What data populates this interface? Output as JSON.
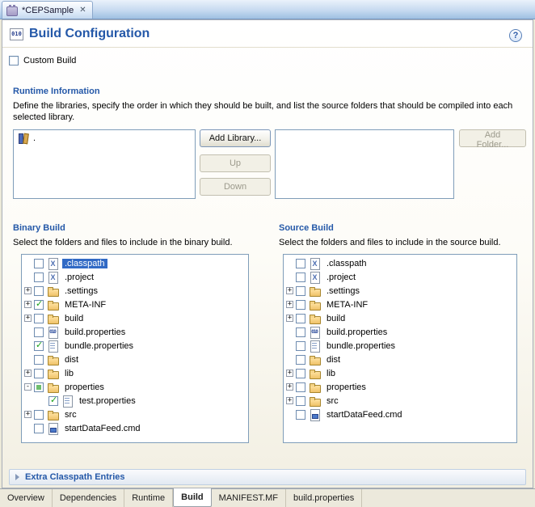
{
  "editor_tab": {
    "title": "*CEPSample"
  },
  "header": {
    "title": "Build Configuration"
  },
  "custom_build": {
    "label": "Custom Build"
  },
  "runtime": {
    "title": "Runtime Information",
    "description": "Define the libraries, specify the order in which they should be built, and list the source folders that should be compiled into each selected library.",
    "libraries": [
      {
        "label": ".",
        "icon": "library"
      }
    ],
    "buttons": {
      "add_library": "Add Library...",
      "up": "Up",
      "down": "Down",
      "add_folder": "Add Folder..."
    }
  },
  "binary_build": {
    "title": "Binary Build",
    "description": "Select the folders and files to include in the binary build.",
    "items": [
      {
        "label": ".classpath",
        "icon": "xml",
        "check": "unchecked",
        "expand": "none",
        "indent": 0,
        "selected": true
      },
      {
        "label": ".project",
        "icon": "xml",
        "check": "unchecked",
        "expand": "none",
        "indent": 0
      },
      {
        "label": ".settings",
        "icon": "folder",
        "check": "unchecked",
        "expand": "plus",
        "indent": 0
      },
      {
        "label": "META-INF",
        "icon": "folder",
        "check": "checked",
        "expand": "plus",
        "indent": 0
      },
      {
        "label": "build",
        "icon": "folder",
        "check": "unchecked",
        "expand": "plus",
        "indent": 0
      },
      {
        "label": "build.properties",
        "icon": "binfile",
        "check": "unchecked",
        "expand": "none",
        "indent": 0
      },
      {
        "label": "bundle.properties",
        "icon": "propfile",
        "check": "checked",
        "expand": "none",
        "indent": 0
      },
      {
        "label": "dist",
        "icon": "folder",
        "check": "unchecked",
        "expand": "none",
        "indent": 0
      },
      {
        "label": "lib",
        "icon": "folder",
        "check": "unchecked",
        "expand": "plus",
        "indent": 0
      },
      {
        "label": "properties",
        "icon": "folder",
        "check": "partial",
        "expand": "minus",
        "indent": 0
      },
      {
        "label": "test.properties",
        "icon": "propfile",
        "check": "checked",
        "expand": "none",
        "indent": 1
      },
      {
        "label": "src",
        "icon": "folder",
        "check": "unchecked",
        "expand": "plus",
        "indent": 0
      },
      {
        "label": "startDataFeed.cmd",
        "icon": "cmdfile",
        "check": "unchecked",
        "expand": "none",
        "indent": 0
      }
    ]
  },
  "source_build": {
    "title": "Source Build",
    "description": "Select the folders and files to include in the source build.",
    "items": [
      {
        "label": ".classpath",
        "icon": "xml",
        "check": "unchecked",
        "expand": "none",
        "indent": 0
      },
      {
        "label": ".project",
        "icon": "xml",
        "check": "unchecked",
        "expand": "none",
        "indent": 0
      },
      {
        "label": ".settings",
        "icon": "folder",
        "check": "unchecked",
        "expand": "plus",
        "indent": 0
      },
      {
        "label": "META-INF",
        "icon": "folder",
        "check": "unchecked",
        "expand": "plus",
        "indent": 0
      },
      {
        "label": "build",
        "icon": "folder",
        "check": "unchecked",
        "expand": "plus",
        "indent": 0
      },
      {
        "label": "build.properties",
        "icon": "binfile",
        "check": "unchecked",
        "expand": "none",
        "indent": 0
      },
      {
        "label": "bundle.properties",
        "icon": "propfile",
        "check": "unchecked",
        "expand": "none",
        "indent": 0
      },
      {
        "label": "dist",
        "icon": "folder",
        "check": "unchecked",
        "expand": "none",
        "indent": 0
      },
      {
        "label": "lib",
        "icon": "folder",
        "check": "unchecked",
        "expand": "plus",
        "indent": 0
      },
      {
        "label": "properties",
        "icon": "folder",
        "check": "unchecked",
        "expand": "plus",
        "indent": 0
      },
      {
        "label": "src",
        "icon": "folder",
        "check": "unchecked",
        "expand": "plus",
        "indent": 0
      },
      {
        "label": "startDataFeed.cmd",
        "icon": "cmdfile",
        "check": "unchecked",
        "expand": "none",
        "indent": 0
      }
    ]
  },
  "extra_classpath": {
    "title": "Extra Classpath Entries"
  },
  "page_tabs": [
    {
      "label": "Overview"
    },
    {
      "label": "Dependencies"
    },
    {
      "label": "Runtime"
    },
    {
      "label": "Build",
      "selected": true
    },
    {
      "label": "MANIFEST.MF"
    },
    {
      "label": "build.properties"
    }
  ],
  "colors": {
    "section_title_blue": "#2458A8",
    "selection_blue": "#316AC5",
    "check_green": "#18A018",
    "form_background": "#F2EFE2"
  }
}
